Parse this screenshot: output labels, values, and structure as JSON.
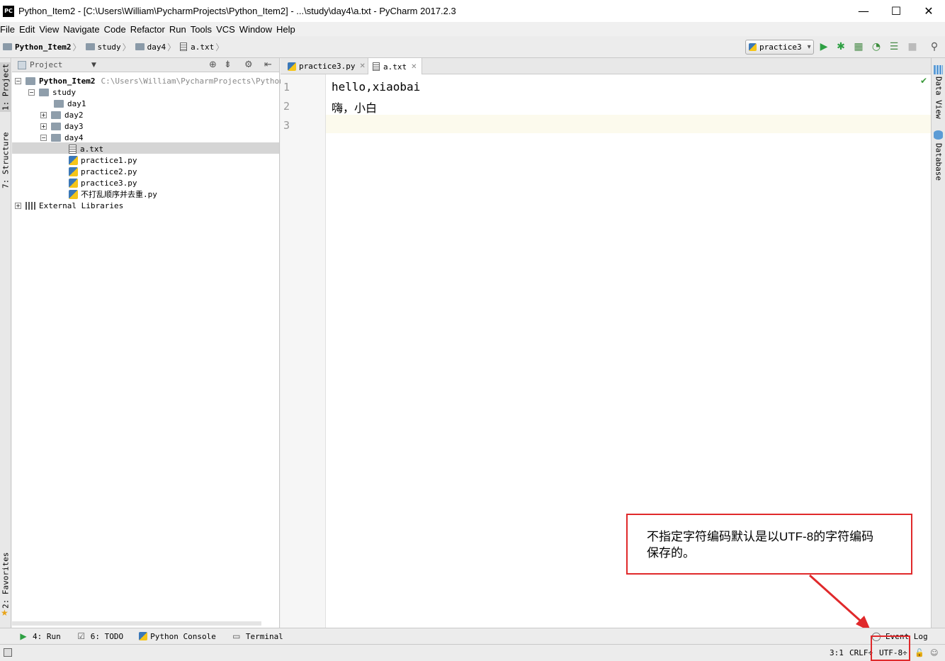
{
  "window": {
    "title": "Python_Item2 - [C:\\Users\\William\\PycharmProjects\\Python_Item2] - ...\\study\\day4\\a.txt - PyCharm 2017.2.3",
    "app_icon_text": "PC",
    "minimize": "—",
    "maximize": "☐",
    "close": "✕"
  },
  "menu": [
    "File",
    "Edit",
    "View",
    "Navigate",
    "Code",
    "Refactor",
    "Run",
    "Tools",
    "VCS",
    "Window",
    "Help"
  ],
  "breadcrumb": [
    "Python_Item2",
    "study",
    "day4",
    "a.txt"
  ],
  "toolbar": {
    "run_config": "practice3",
    "run_config_arrow": "▾"
  },
  "left_tool_windows": {
    "project": "1: Project",
    "structure": "7: Structure",
    "favorites": "2: Favorites"
  },
  "right_tool_windows": {
    "data_view": "Data View",
    "database": "Database"
  },
  "project_panel": {
    "header": "Project",
    "tree": [
      {
        "label": "Python_Item2",
        "path": "C:\\Users\\William\\PycharmProjects\\Python_I",
        "type": "root",
        "expanded": true
      },
      {
        "label": "study",
        "type": "folder",
        "expanded": true
      },
      {
        "label": "day1",
        "type": "folder"
      },
      {
        "label": "day2",
        "type": "folder",
        "expanded": false
      },
      {
        "label": "day3",
        "type": "folder",
        "expanded": false
      },
      {
        "label": "day4",
        "type": "folder",
        "expanded": true
      },
      {
        "label": "a.txt",
        "type": "txt",
        "selected": true
      },
      {
        "label": "practice1.py",
        "type": "py"
      },
      {
        "label": "practice2.py",
        "type": "py"
      },
      {
        "label": "practice3.py",
        "type": "py"
      },
      {
        "label": "不打乱顺序并去重.py",
        "type": "py"
      },
      {
        "label": "External Libraries",
        "type": "lib"
      }
    ]
  },
  "editor": {
    "tabs": [
      {
        "label": "practice3.py",
        "active": false
      },
      {
        "label": "a.txt",
        "active": true
      }
    ],
    "tab_close": "✕",
    "line_numbers": [
      "1",
      "2",
      "3"
    ],
    "lines": [
      "hello,xiaobai",
      "嗨，小白",
      ""
    ],
    "inspection_ok": "✔"
  },
  "callout": {
    "line1": "不指定字符编码默认是以UTF-8的字符编码",
    "line2": "保存的。"
  },
  "bottom_tabs": [
    {
      "label": "4: Run",
      "icon": "run-icon"
    },
    {
      "label": "6: TODO",
      "icon": "todo-icon"
    },
    {
      "label": "Python Console",
      "icon": "python-console-icon"
    },
    {
      "label": "Terminal",
      "icon": "terminal-icon"
    }
  ],
  "event_log": "Event Log",
  "status": {
    "position": "3:1",
    "line_separator": "CRLF÷",
    "encoding": "UTF-8÷"
  },
  "colors": {
    "callout_border": "#e0292b",
    "run_green": "#2ea043",
    "selection": "#d5d5d5",
    "caret_row": "#fcfaed"
  }
}
